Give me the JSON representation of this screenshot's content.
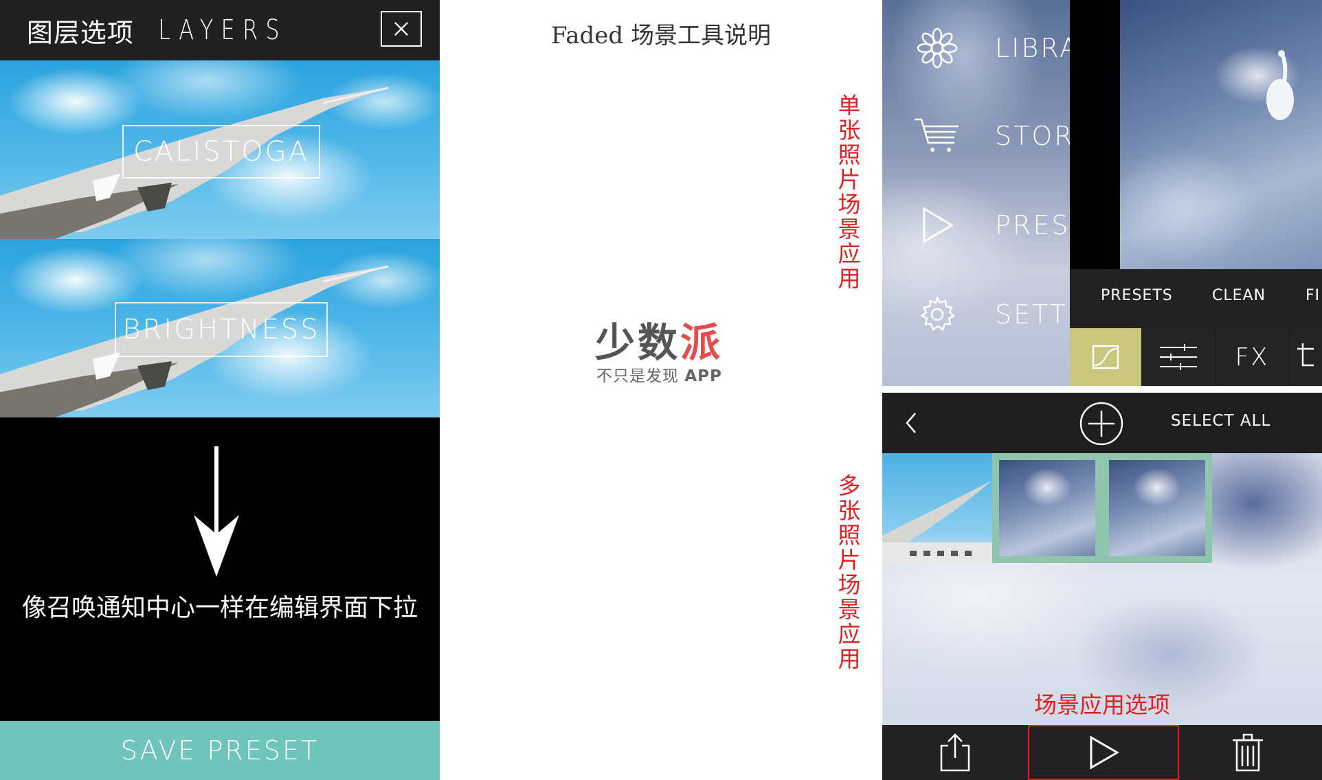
{
  "left_panel": {
    "title_cn": "图层选项",
    "title_en": "LAYERS",
    "layers": [
      {
        "name": "CALISTOGA"
      },
      {
        "name": "BRIGHTNESS"
      }
    ],
    "hint": "像召唤通知中心一样在编辑界面下拉",
    "save_label": "SAVE PRESET"
  },
  "middle": {
    "title": "Faded  场景工具说明",
    "logo": {
      "main_gray": "少数",
      "main_red": "派",
      "sub_text": "不只是发现",
      "sub_bold": "APP"
    },
    "label_single": "单张照片场景应用",
    "label_multi": "多张照片场景应用"
  },
  "right_top": {
    "menu": [
      {
        "label": "LIBRAR",
        "icon": "flower-icon"
      },
      {
        "label": "STORE",
        "icon": "cart-icon"
      },
      {
        "label": "PRESET",
        "icon": "play-icon"
      },
      {
        "label": "SETTIN",
        "icon": "gear-icon"
      }
    ],
    "tabs": [
      "PRESETS",
      "CLEAN",
      "FI"
    ],
    "tools": {
      "fx_label": "FX"
    }
  },
  "right_bottom": {
    "select_all": "SELECT ALL",
    "scene_options_label": "场景应用选项"
  },
  "colors": {
    "save_button": "#6fc5bb",
    "curve_tool": "#c9c77d",
    "annotation_red": "#e02020",
    "selection_border": "#8fc5ad"
  }
}
